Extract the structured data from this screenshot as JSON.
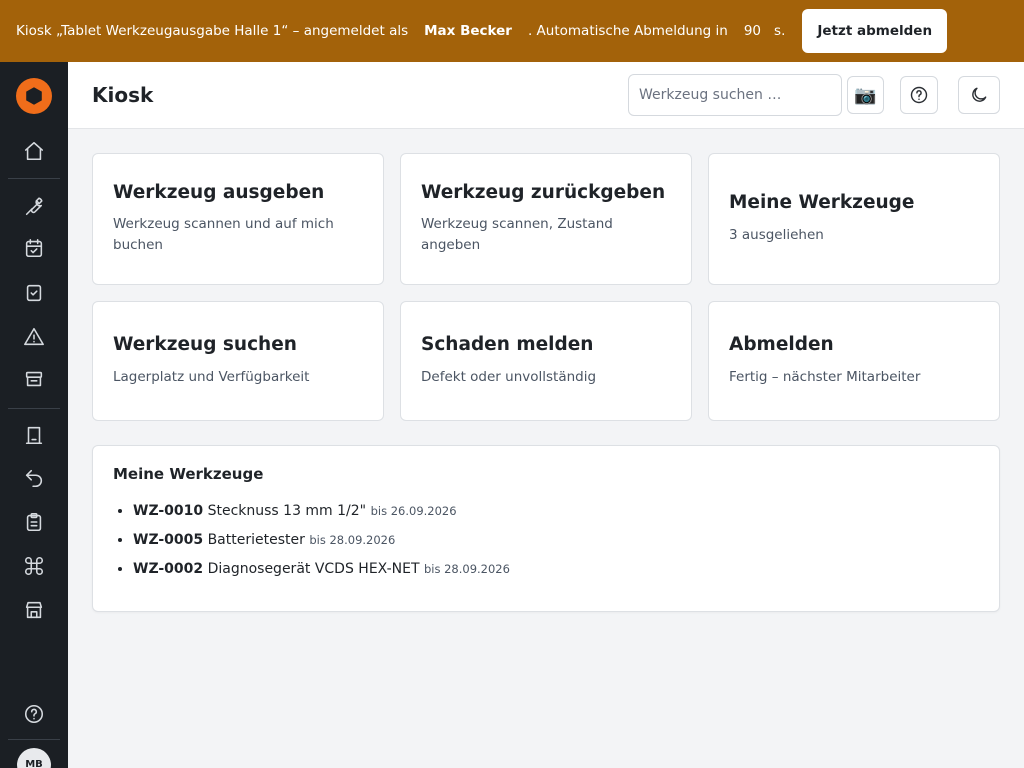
{
  "banner": {
    "prefix": "Kiosk „Tablet Werkzeugausgabe Halle 1“ – angemeldet als",
    "user": "Max Becker",
    "auto_logout": ". Automatische Abmeldung in",
    "seconds": "90",
    "unit": "s.",
    "logout_button": "Jetzt abmelden"
  },
  "sidebar": {
    "items": [
      {
        "icon": "home-icon"
      },
      {
        "icon": "wrench-icon"
      },
      {
        "icon": "calendar-check-icon"
      },
      {
        "icon": "checkbox-icon"
      },
      {
        "icon": "warning-icon"
      },
      {
        "icon": "storage-icon"
      },
      {
        "icon": "checkout-icon"
      },
      {
        "icon": "return-icon"
      },
      {
        "icon": "clipboard-icon"
      },
      {
        "icon": "command-icon"
      },
      {
        "icon": "store-icon"
      }
    ],
    "help_icon": "help-icon",
    "avatar_initials": "MB"
  },
  "header": {
    "title": "Kiosk",
    "search_placeholder": "Werkzeug suchen …",
    "camera_icon": "📷"
  },
  "tiles": [
    {
      "title": "Werkzeug ausgeben",
      "subtitle": "Werkzeug scannen und auf mich buchen"
    },
    {
      "title": "Werkzeug zurückgeben",
      "subtitle": "Werkzeug scannen, Zustand angeben"
    },
    {
      "title": "Meine Werkzeuge",
      "subtitle": "3 ausgeliehen"
    },
    {
      "title": "Werkzeug suchen",
      "subtitle": "Lagerplatz und Verfügbarkeit"
    },
    {
      "title": "Schaden melden",
      "subtitle": "Defekt oder unvollständig"
    },
    {
      "title": "Abmelden",
      "subtitle": "Fertig – nächster Mitarbeiter"
    }
  ],
  "my_tools": {
    "heading": "Meine Werkzeuge",
    "items": [
      {
        "code": "WZ-0010",
        "name": "Stecknuss 13 mm 1/2\"",
        "due": "bis 26.09.2026"
      },
      {
        "code": "WZ-0005",
        "name": "Batterietester",
        "due": "bis 28.09.2026"
      },
      {
        "code": "WZ-0002",
        "name": "Diagnosegerät VCDS HEX-NET",
        "due": "bis 28.09.2026"
      }
    ]
  }
}
